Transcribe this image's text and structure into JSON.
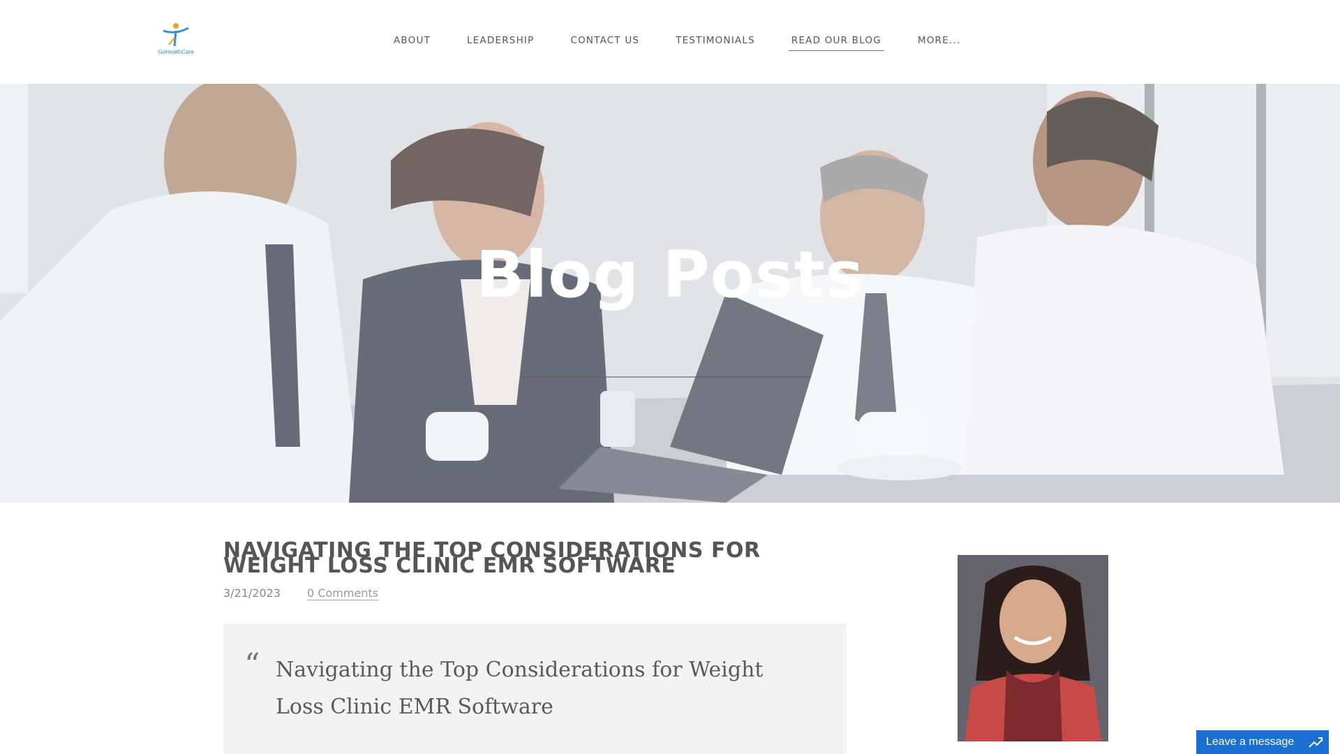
{
  "brand": {
    "logo_text": "GoHealthCare"
  },
  "nav": {
    "items": [
      {
        "label": "ABOUT"
      },
      {
        "label": "LEADERSHIP"
      },
      {
        "label": "CONTACT US"
      },
      {
        "label": "TESTIMONIALS"
      },
      {
        "label": "READ OUR BLOG",
        "active": true
      },
      {
        "label": "MORE..."
      }
    ]
  },
  "hero": {
    "title": "Blog Posts"
  },
  "post": {
    "title": "NAVIGATING THE TOP CONSIDERATIONS FOR WEIGHT LOSS CLINIC EMR SOFTWARE",
    "date": "3/21/2023",
    "comments": "0 Comments",
    "quote_mark": "“",
    "quote": "Navigating the Top Considerations for Weight Loss Clinic EMR Software"
  },
  "chat": {
    "label": "Leave a message",
    "icon": "maximize-icon"
  },
  "colors": {
    "nav_text": "#555555",
    "chat_bg": "#1b6fd0",
    "quote_bg": "#f3f3f3"
  }
}
